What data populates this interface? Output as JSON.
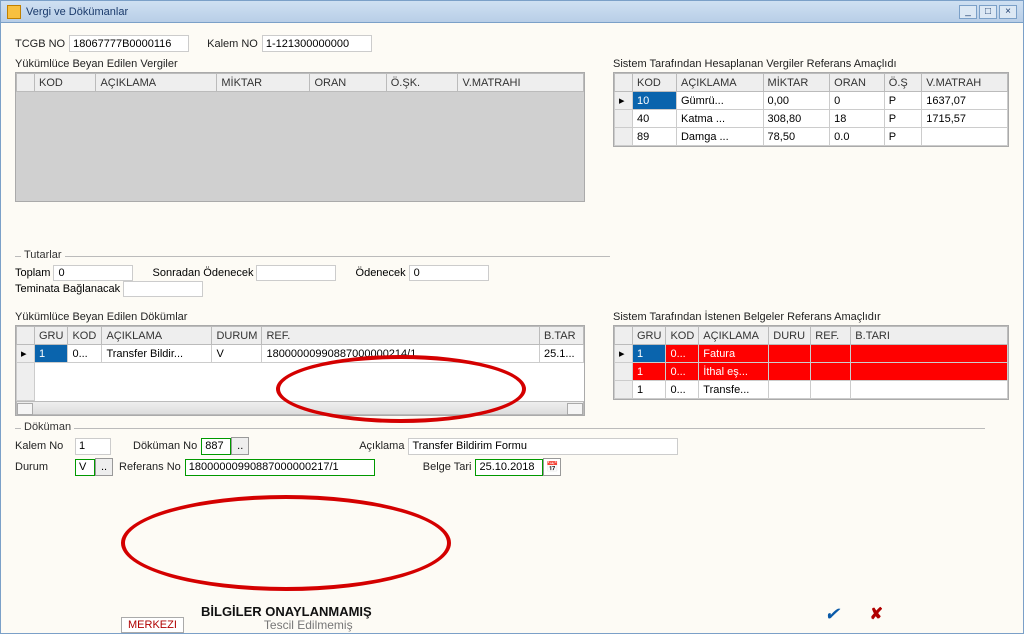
{
  "window": {
    "title": "Vergi ve Dökümanlar"
  },
  "header": {
    "tcgb_label": "TCGB NO",
    "tcgb_value": "18067777B0000116",
    "kalem_label": "Kalem NO",
    "kalem_value": "1-121300000000"
  },
  "tax_declared": {
    "title": "Yükümlüce Beyan Edilen Vergiler",
    "cols": [
      "KOD",
      "AÇIKLAMA",
      "MİKTAR",
      "ORAN",
      "Ö.ŞK.",
      "V.MATRAHI"
    ]
  },
  "tax_system": {
    "title": "Sistem Tarafından Hesaplanan Vergiler  Referans Amaçlıdı",
    "cols": [
      "KOD",
      "AÇIKLAMA",
      "MİKTAR",
      "ORAN",
      "Ö.Ş",
      "V.MATRAH"
    ],
    "rows": [
      {
        "kod": "10",
        "aciklama": "Gümrü...",
        "miktar": "0,00",
        "oran": "0",
        "os": "P",
        "matrah": "1637,07"
      },
      {
        "kod": "40",
        "aciklama": "Katma ...",
        "miktar": "308,80",
        "oran": "18",
        "os": "P",
        "matrah": "1715,57"
      },
      {
        "kod": "89",
        "aciklama": "Damga ...",
        "miktar": "78,50",
        "oran": "0.0",
        "os": "P",
        "matrah": ""
      }
    ]
  },
  "amounts": {
    "legend": "Tutarlar",
    "toplam_label": "Toplam",
    "toplam_value": "0",
    "sonradan_label": "Sonradan Ödenecek",
    "sonradan_value": "",
    "odenecek_label": "Ödenecek",
    "odenecek_value": "0",
    "teminat_label": "Teminata Bağlanacak",
    "teminat_value": ""
  },
  "docs_declared": {
    "title": "Yükümlüce Beyan Edilen Dökümlar",
    "cols": [
      "GRU",
      "KOD",
      "AÇIKLAMA",
      "DURUM",
      "REF.",
      "B.TAR"
    ],
    "rows": [
      {
        "gru": "1",
        "kod": "0...",
        "aciklama": "Transfer Bildir...",
        "durum": "V",
        "ref": "18000000990887000000214/1",
        "btar": "25.1..."
      }
    ]
  },
  "docs_system": {
    "title": "Sistem Tarafından İstenen Belgeler Referans Amaçlıdır",
    "cols": [
      "GRU",
      "KOD",
      "AÇIKLAMA",
      "DURU",
      "REF.",
      "B.TARI"
    ],
    "rows": [
      {
        "gru": "1",
        "kod": "0...",
        "aciklama": "Fatura",
        "durum": "",
        "ref": "",
        "btari": "",
        "red": true
      },
      {
        "gru": "1",
        "kod": "0...",
        "aciklama": "İthal eş...",
        "durum": "",
        "ref": "",
        "btari": "",
        "red": true
      },
      {
        "gru": "1",
        "kod": "0...",
        "aciklama": "Transfe...",
        "durum": "",
        "ref": "",
        "btari": "",
        "red": false
      }
    ]
  },
  "dokuman": {
    "legend": "Döküman",
    "kalem_label": "Kalem No",
    "kalem_value": "1",
    "dokuman_label": "Döküman No",
    "dokuman_value": "887",
    "aciklama_label": "Açıklama",
    "aciklama_value": "Transfer Bildirim Formu",
    "durum_label": "Durum",
    "durum_value": "V",
    "referans_label": "Referans No",
    "referans_value": "18000000990887000000217/1",
    "belge_label": "Belge Tari",
    "belge_value": "25.10.2018"
  },
  "footer": {
    "approval": "BİLGİLER ONAYLANMAMIŞ",
    "merkezi": "MERKEZI",
    "tescil": "Tescil Edilmemiş"
  }
}
